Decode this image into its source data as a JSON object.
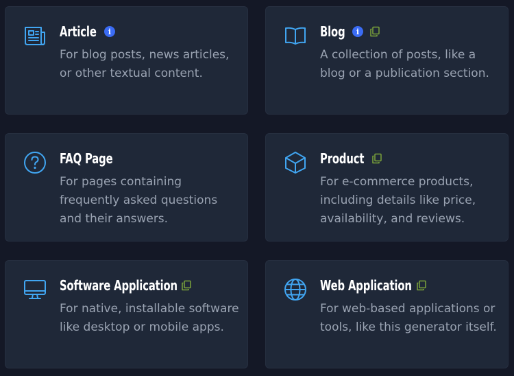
{
  "cards": [
    {
      "title": "Article",
      "description": "For blog posts, news articles, or other textual content.",
      "icon": "newspaper-icon",
      "badges": [
        "info-icon"
      ]
    },
    {
      "title": "Blog",
      "description": "A collection of posts, like a blog or a publication section.",
      "icon": "book-open-icon",
      "badges": [
        "info-icon",
        "copy-icon"
      ]
    },
    {
      "title": "FAQ Page",
      "description": "For pages containing frequently asked questions and their answers.",
      "icon": "question-circle-icon",
      "badges": []
    },
    {
      "title": "Product",
      "description": "For e-commerce products, including details like price, availability, and reviews.",
      "icon": "cube-icon",
      "badges": [
        "copy-icon"
      ]
    },
    {
      "title": "Software Application",
      "description": "For native, installable software like desktop or mobile apps.",
      "icon": "monitor-icon",
      "badges": [
        "copy-icon"
      ]
    },
    {
      "title": "Web Application",
      "description": "For web-based applications or tools, like this generator itself.",
      "icon": "globe-icon",
      "badges": [
        "copy-icon"
      ]
    }
  ],
  "info_badge_glyph": "i",
  "colors": {
    "background": "#141826",
    "card": "#1f2838",
    "icon_blue": "#41a6f2",
    "info_blue": "#3b6cf4",
    "copy_green": "#7ba33a",
    "title": "#ffffff",
    "description": "#9aa3b2"
  }
}
